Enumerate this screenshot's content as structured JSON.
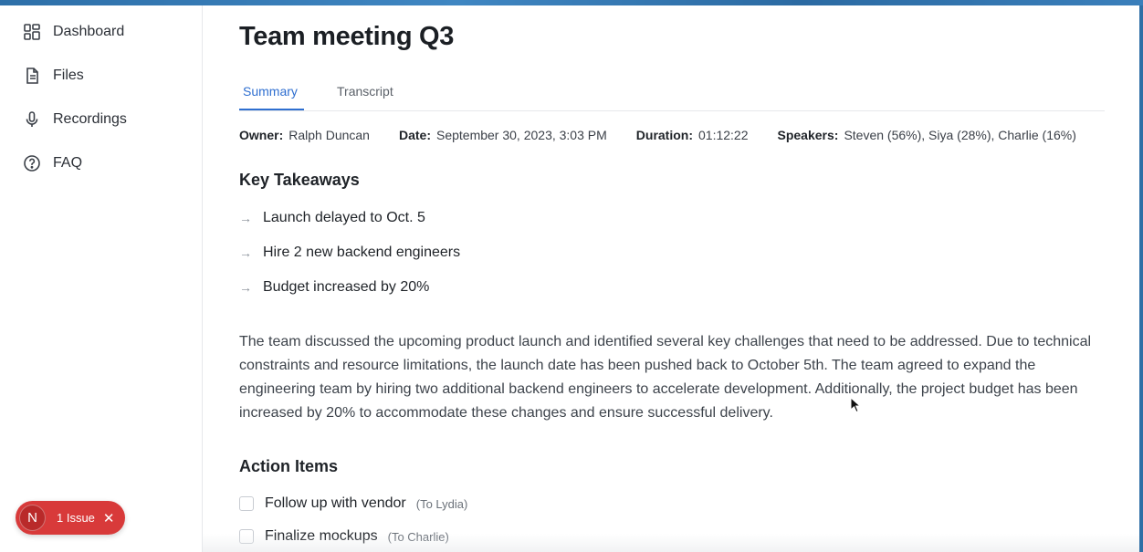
{
  "sidebar": {
    "items": [
      {
        "label": "Dashboard",
        "icon": "dashboard-icon"
      },
      {
        "label": "Files",
        "icon": "file-icon"
      },
      {
        "label": "Recordings",
        "icon": "microphone-icon"
      },
      {
        "label": "FAQ",
        "icon": "help-circle-icon"
      }
    ]
  },
  "issue_badge": {
    "avatar_letter": "N",
    "label": "1 Issue",
    "close_glyph": "✕",
    "color": "#d83a3a"
  },
  "page": {
    "title": "Team meeting Q3"
  },
  "tabs": [
    {
      "label": "Summary",
      "active": true
    },
    {
      "label": "Transcript",
      "active": false
    }
  ],
  "meta": {
    "owner_label": "Owner:",
    "owner": "Ralph Duncan",
    "date_label": "Date:",
    "date": "September 30, 2023, 3:03 PM",
    "duration_label": "Duration:",
    "duration": "01:12:22",
    "speakers_label": "Speakers:",
    "speakers": "Steven (56%), Siya (28%), Charlie (16%)"
  },
  "key_takeaways": {
    "heading": "Key Takeaways",
    "items": [
      "Launch delayed to Oct. 5",
      "Hire 2 new backend engineers",
      "Budget increased by 20%"
    ]
  },
  "summary_text": "The team discussed the upcoming product launch and identified several key challenges that need to be addressed. Due to technical constraints and resource limitations, the launch date has been pushed back to October 5th. The team agreed to expand the engineering team by hiring two additional backend engineers to accelerate development. Additionally, the project budget has been increased by 20% to accommodate these changes and ensure successful delivery.",
  "action_items": {
    "heading": "Action Items",
    "items": [
      {
        "text": "Follow up with vendor",
        "assignee": "(To Lydia)",
        "checked": false
      },
      {
        "text": "Finalize mockups",
        "assignee": "(To Charlie)",
        "checked": false
      }
    ]
  },
  "colors": {
    "accent": "#2f6fd0",
    "browser_frame": "#2f6fa6"
  }
}
